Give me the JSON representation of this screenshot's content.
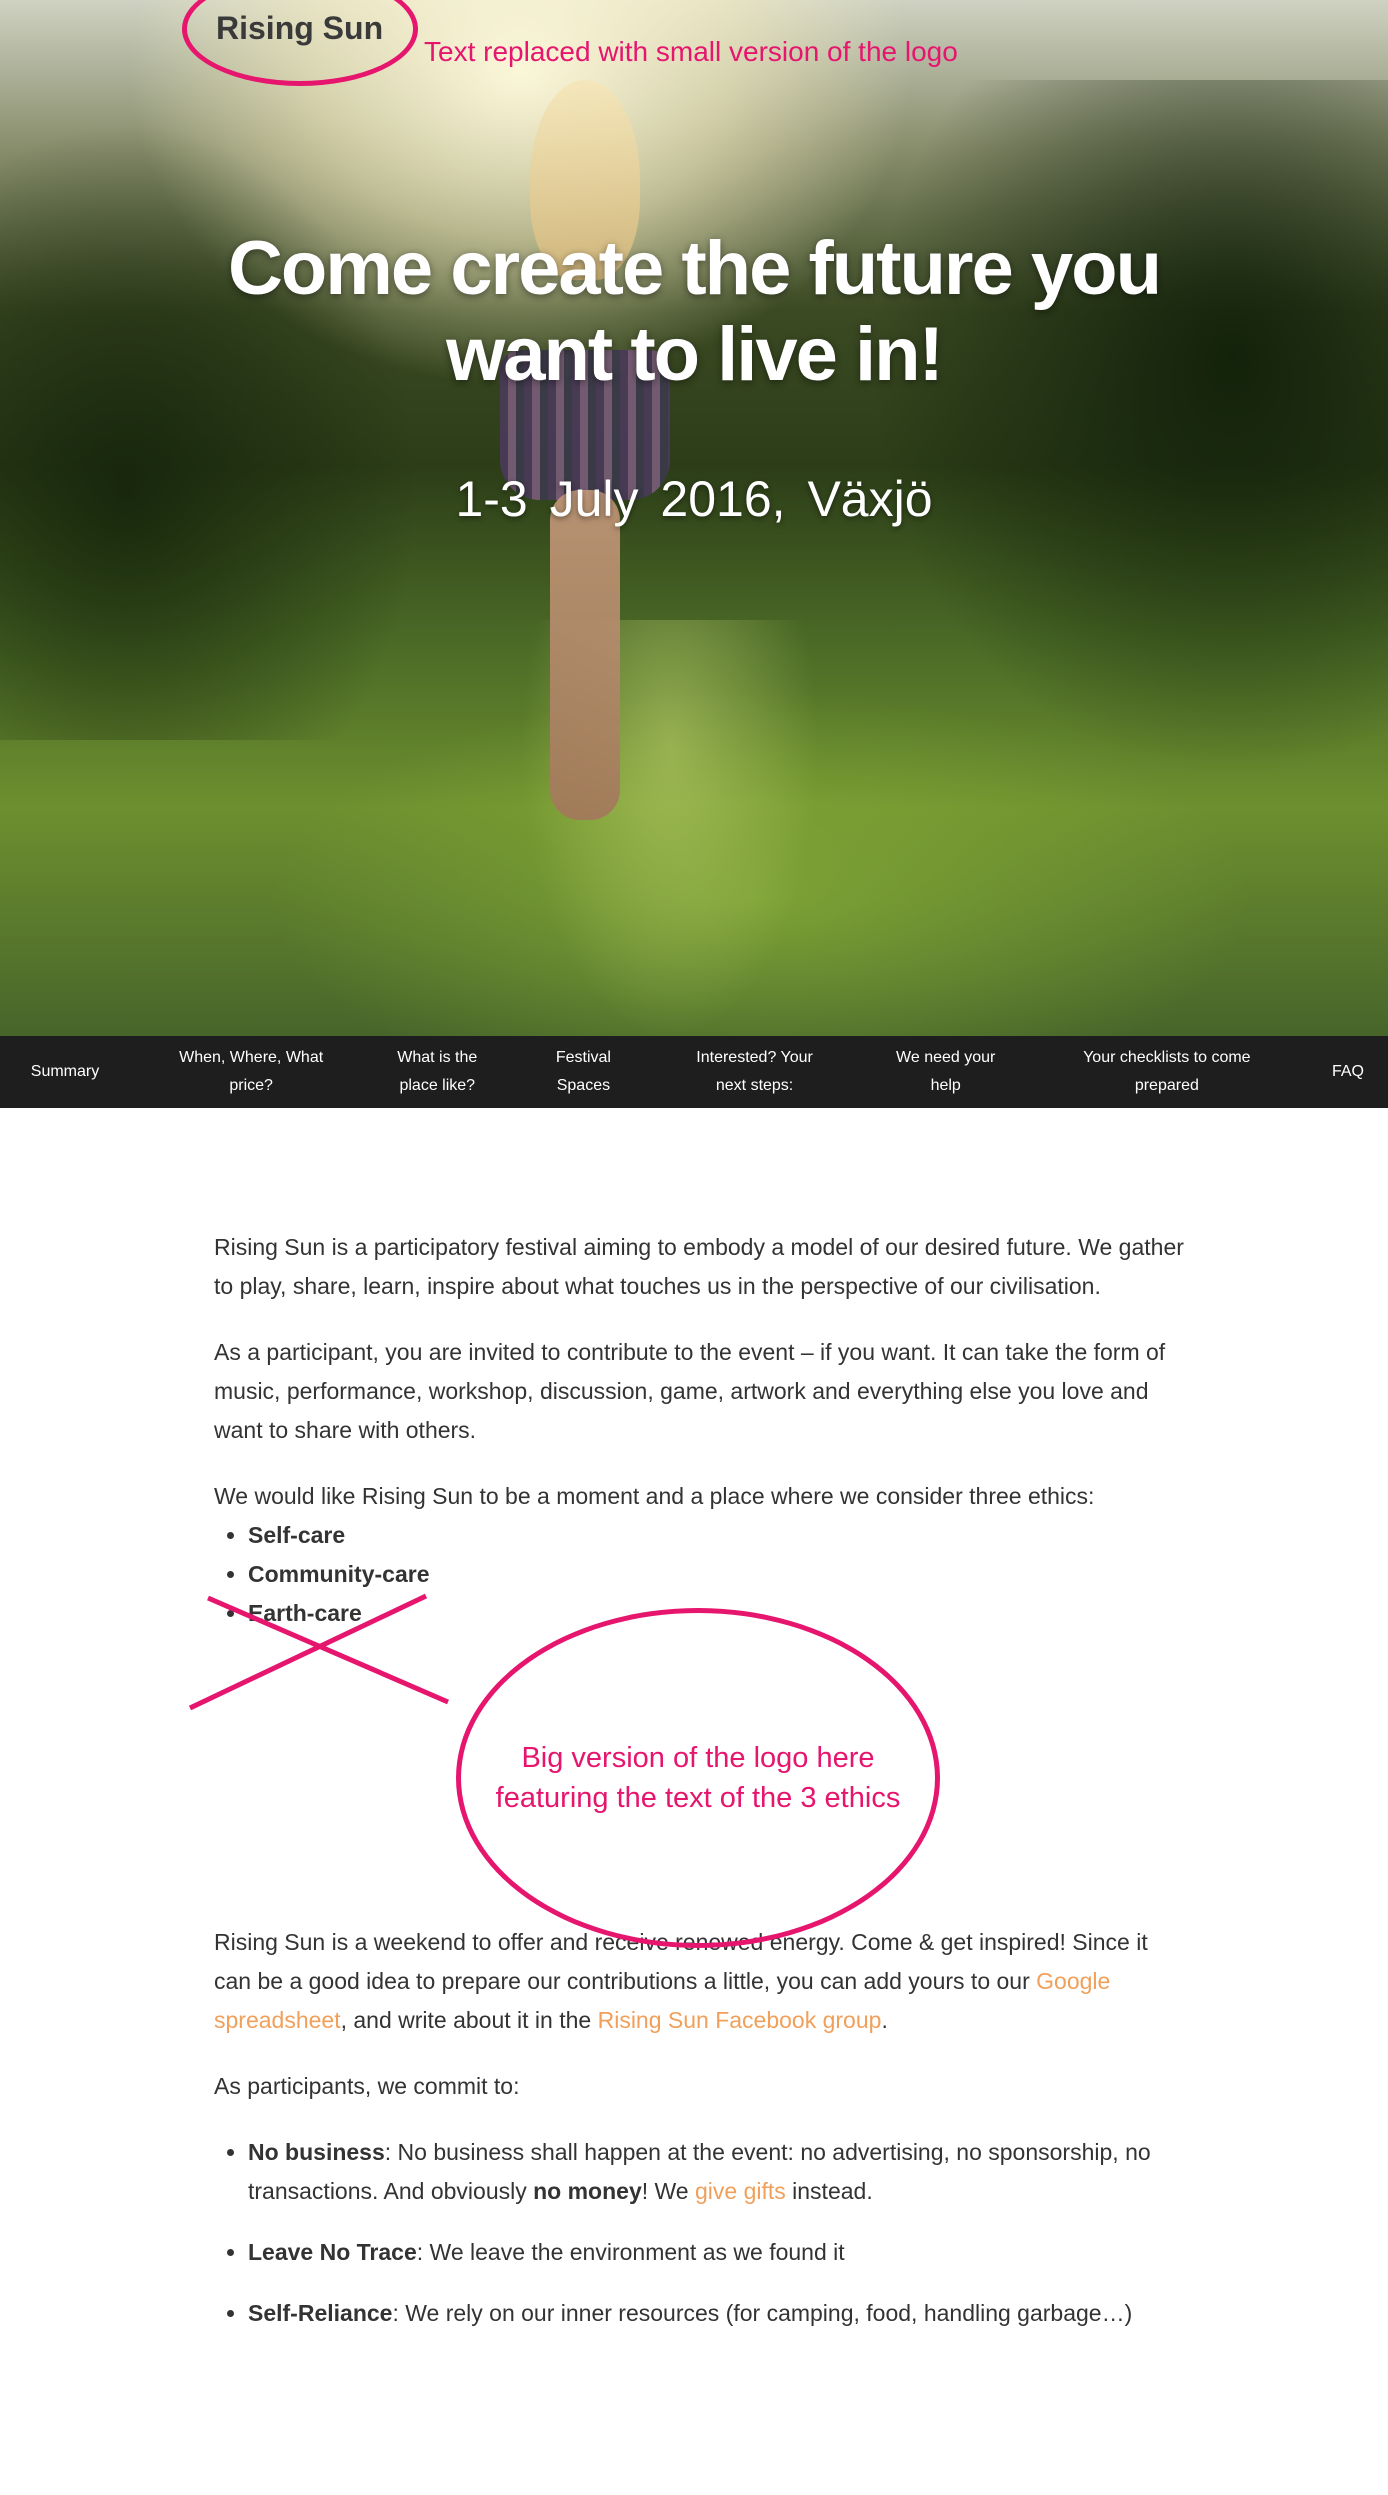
{
  "header": {
    "logo_text": "Rising Sun",
    "annotation": "Text replaced with small version of the logo"
  },
  "hero": {
    "title_line1": "Come create the future you",
    "title_line2": "want to live in!",
    "date": "1-3 July 2016, Växjö"
  },
  "nav": {
    "items": [
      {
        "line1": "Summary",
        "line2": ""
      },
      {
        "line1": "When, Where, What",
        "line2": "price?"
      },
      {
        "line1": "What is the",
        "line2": "place like?"
      },
      {
        "line1": "Festival",
        "line2": "Spaces"
      },
      {
        "line1": "Interested? Your",
        "line2": "next steps:"
      },
      {
        "line1": "We need your",
        "line2": "help"
      },
      {
        "line1": "Your checklists to come",
        "line2": "prepared"
      },
      {
        "line1": "FAQ",
        "line2": ""
      }
    ]
  },
  "content": {
    "intro": "Rising Sun is a participatory festival aiming to embody a model of our desired future. We gather to play, share, learn, inspire about what touches us in the perspective of our civilisation.",
    "participant": "As a participant, you are invited to contribute to the event – if you want. It can take the form of music, performance, workshop, discussion, game, artwork and everything else you love and want to share with others.",
    "ethics_intro": "We would like Rising Sun to be a moment and a place where we consider three ethics:",
    "ethics": [
      "Self-care",
      "Community-care",
      "Earth-care"
    ],
    "ellipse_annotation_line1": "Big version of the logo here",
    "ellipse_annotation_line2": "featuring the text of the 3 ethics",
    "weekend_part1": "Rising Sun is a weekend to offer and receive renewed energy. Come & get inspired! Since it can be a good idea to prepare our contributions a little, you can add yours to our ",
    "spreadsheet_link": "Google spreadsheet",
    "weekend_part2": ", and write about it in the ",
    "facebook_link": "Rising Sun Facebook group",
    "weekend_part3": ".",
    "commit_intro": "As participants, we commit to:",
    "commit": {
      "no_business_title": "No business",
      "no_business_text": ": No business shall happen at the event: no advertising, no sponsorship, no transactions. And obviously ",
      "no_money": "no money",
      "no_money_after": "! We ",
      "gifts_link": "give gifts",
      "gifts_after": " instead.",
      "leave_title": "Leave No Trace",
      "leave_text": ": We leave the environment as we found it",
      "self_title": "Self-Reliance",
      "self_text": ": We rely on our inner resources (for camping, food, handling garbage…)"
    }
  },
  "colors": {
    "annotation": "#e6156e",
    "link": "#f0a05a",
    "nav_bg": "#1e1e1e"
  }
}
